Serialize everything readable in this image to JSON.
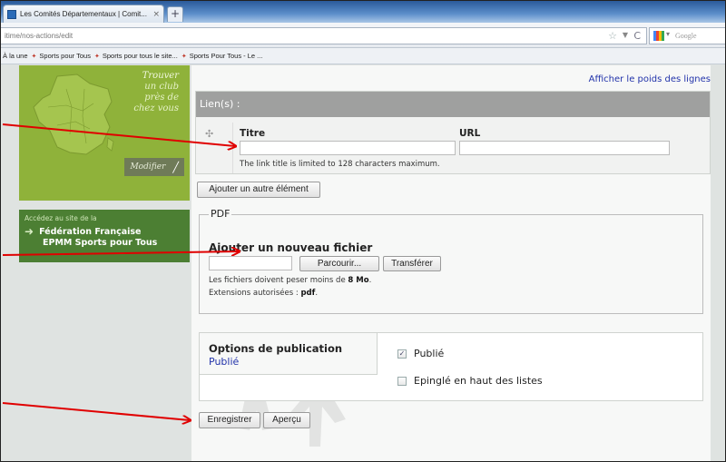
{
  "browser": {
    "tab_title": "Les Comités Départementaux | Comit...",
    "tab_close": "×",
    "new_tab": "+",
    "url": "itime/nos-actions/edit",
    "search_placeholder": "Google",
    "bookmarks": [
      {
        "label": "À la une"
      },
      {
        "label": "Sports pour Tous"
      },
      {
        "label": "Sports pour tous le site..."
      },
      {
        "label": "Sports Pour Tous - Le ..."
      }
    ]
  },
  "sidebar": {
    "map_text": [
      "Trouver",
      "un club",
      "près de",
      "chez vous"
    ],
    "modifier_label": "Modifier",
    "fed_small": "Accédez au site de la",
    "fed_line1": "Fédération Française",
    "fed_line2": "EPMM Sports pour Tous"
  },
  "content": {
    "weights_link": "Afficher le poids des lignes",
    "links": {
      "header": "Lien(s) :",
      "col_title": "Titre",
      "col_url": "URL",
      "title_value": "",
      "url_value": "",
      "help": "The link title is limited to 128 characters maximum."
    },
    "add_button": "Ajouter un autre élément",
    "pdf": {
      "legend": "PDF",
      "add_title": "Ajouter un nouveau fichier",
      "browse_button": "Parcourir...",
      "upload_button": "Transférer",
      "help1_prefix": "Les fichiers doivent peser moins de ",
      "help1_bold": "8 Mo",
      "help1_suffix": ".",
      "help2_prefix": "Extensions autorisées : ",
      "help2_bold": "pdf",
      "help2_suffix": "."
    },
    "publication": {
      "title": "Options de publication",
      "status": "Publié",
      "options": [
        {
          "label": "Publié",
          "checked": true
        },
        {
          "label": "Epinglé en haut des listes",
          "checked": false
        }
      ]
    },
    "save_button": "Enregistrer",
    "preview_button": "Aperçu"
  },
  "colors": {
    "annotation_arrow": "#e00000",
    "sidebar_green": "#8fb23a",
    "fed_green": "#4c7f33",
    "link_blue": "#2233aa"
  }
}
